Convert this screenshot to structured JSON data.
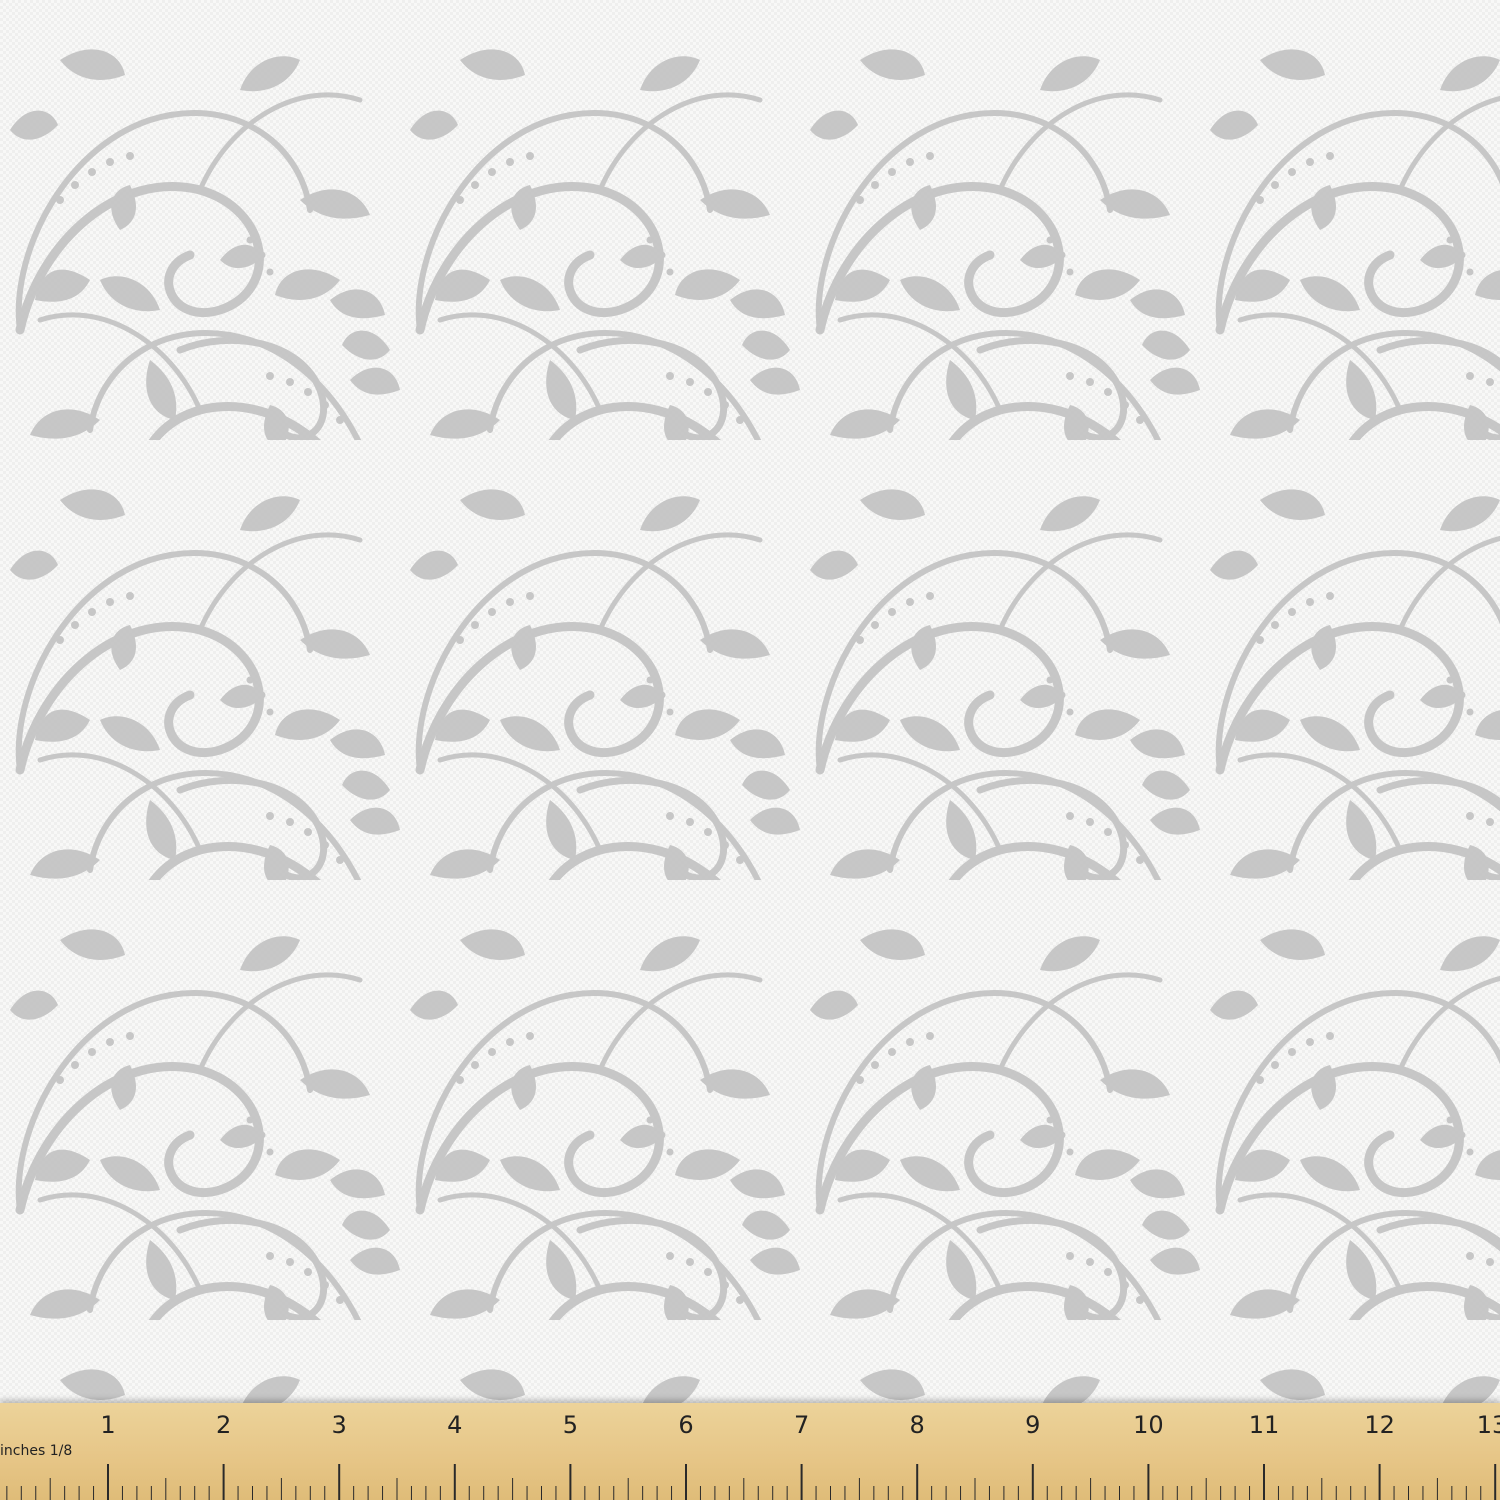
{
  "ruler": {
    "unit_label": "inches 1/8",
    "numbers": [
      "1",
      "2",
      "3",
      "4",
      "5",
      "6",
      "7",
      "8",
      "9",
      "10",
      "11",
      "12",
      "13"
    ]
  },
  "colors": {
    "fabric_background": "#f7f7f6",
    "pattern_gray": "#c4c4c4",
    "ruler_wood": "#e6c586"
  },
  "pattern": {
    "motif": "gray floral damask swirl on white woven fabric"
  }
}
